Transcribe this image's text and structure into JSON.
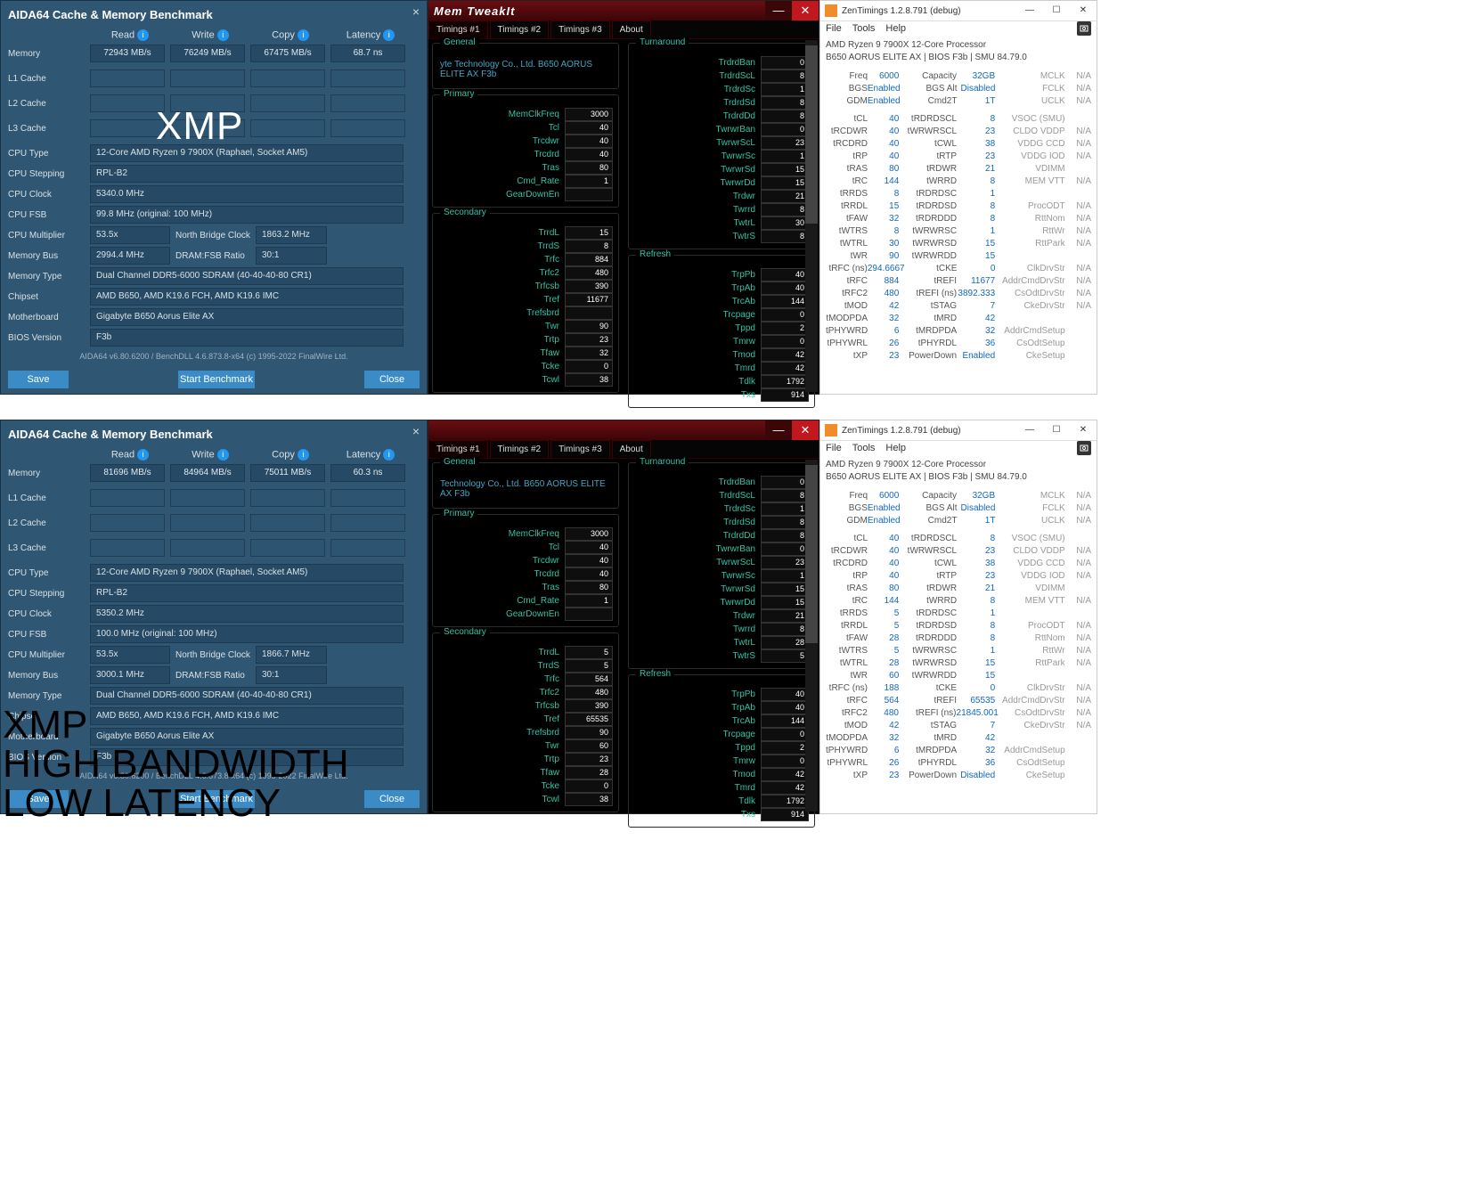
{
  "overlay_top": "XMP",
  "overlay_bottom": [
    "XMP",
    "HIGH BANDWIDTH",
    "LOW LATENCY"
  ],
  "aida": {
    "title": "AIDA64 Cache & Memory Benchmark",
    "headers": [
      "Read",
      "Write",
      "Copy",
      "Latency"
    ],
    "rows": [
      {
        "l": "Memory",
        "v": [
          "72943 MB/s",
          "76249 MB/s",
          "67475 MB/s",
          "68.7 ns"
        ]
      },
      {
        "l": "L1 Cache",
        "v": [
          "",
          "",
          "",
          ""
        ]
      },
      {
        "l": "L2 Cache",
        "v": [
          "",
          "",
          "",
          ""
        ]
      },
      {
        "l": "L3 Cache",
        "v": [
          "",
          "",
          "",
          ""
        ]
      }
    ],
    "info": [
      {
        "l": "CPU Type",
        "v": "12-Core AMD Ryzen 9 7900X  (Raphael, Socket AM5)"
      },
      {
        "l": "CPU Stepping",
        "v": "RPL-B2"
      },
      {
        "l": "CPU Clock",
        "v": "5340.0 MHz"
      },
      {
        "l": "CPU FSB",
        "v": "99.8 MHz  (original: 100 MHz)"
      }
    ],
    "multi": {
      "l": "CPU Multiplier",
      "v": "53.5x",
      "l2": "North Bridge Clock",
      "v2": "1863.2 MHz"
    },
    "bus": {
      "l": "Memory Bus",
      "v": "2994.4 MHz",
      "l2": "DRAM:FSB Ratio",
      "v2": "30:1"
    },
    "info2": [
      {
        "l": "Memory Type",
        "v": "Dual Channel DDR5-6000 SDRAM  (40-40-40-80 CR1)"
      },
      {
        "l": "Chipset",
        "v": "AMD B650, AMD K19.6 FCH, AMD K19.6 IMC"
      },
      {
        "l": "Motherboard",
        "v": "Gigabyte B650 Aorus Elite AX"
      },
      {
        "l": "BIOS Version",
        "v": "F3b"
      }
    ],
    "footer": "AIDA64 v6.80.6200 / BenchDLL 4.6.873.8-x64  (c) 1995-2022 FinalWire Ltd.",
    "btn": {
      "save": "Save",
      "start": "Start Benchmark",
      "close": "Close"
    }
  },
  "aida2": {
    "rows": [
      {
        "l": "Memory",
        "v": [
          "81696 MB/s",
          "84964 MB/s",
          "75011 MB/s",
          "60.3 ns"
        ]
      },
      {
        "l": "L1 Cache",
        "v": [
          "",
          "",
          "",
          ""
        ]
      },
      {
        "l": "L2 Cache",
        "v": [
          "",
          "",
          "",
          ""
        ]
      },
      {
        "l": "L3 Cache",
        "v": [
          "",
          "",
          "",
          ""
        ]
      }
    ],
    "info": [
      {
        "l": "CPU Type",
        "v": "12-Core AMD Ryzen 9 7900X  (Raphael, Socket AM5)"
      },
      {
        "l": "CPU Stepping",
        "v": "RPL-B2"
      },
      {
        "l": "CPU Clock",
        "v": "5350.2 MHz"
      },
      {
        "l": "CPU FSB",
        "v": "100.0 MHz  (original: 100 MHz)"
      }
    ],
    "multi": {
      "l": "CPU Multiplier",
      "v": "53.5x",
      "l2": "North Bridge Clock",
      "v2": "1866.7 MHz"
    },
    "bus": {
      "l": "Memory Bus",
      "v": "3000.1 MHz",
      "l2": "DRAM:FSB Ratio",
      "v2": "30:1"
    },
    "info2": [
      {
        "l": "Memory Type",
        "v": "Dual Channel DDR5-6000 SDRAM  (40-40-40-80 CR1)"
      },
      {
        "l": "Chipset",
        "v": "AMD B650, AMD K19.6 FCH, AMD K19.6 IMC"
      },
      {
        "l": "Motherboard",
        "v": "Gigabyte B650 Aorus Elite AX"
      },
      {
        "l": "BIOS Version",
        "v": "F3b"
      }
    ]
  },
  "mt": {
    "title": "Mem TweakIt",
    "tabs": [
      "Timings #1",
      "Timings #2",
      "Timings #3",
      "About"
    ],
    "mb": "yte Technology Co., Ltd. B650 AORUS ELITE AX F3b",
    "mb2": "Technology Co., Ltd. B650 AORUS ELITE AX F3b",
    "primary": [
      [
        "MemClkFreq",
        "3000"
      ],
      [
        "Tcl",
        "40"
      ],
      [
        "Trcdwr",
        "40"
      ],
      [
        "Trcdrd",
        "40"
      ],
      [
        "Tras",
        "80"
      ],
      [
        "Cmd_Rate",
        "1"
      ],
      [
        "GearDownEn",
        ""
      ]
    ],
    "secondary": [
      [
        "TrrdL",
        "15"
      ],
      [
        "TrrdS",
        "8"
      ],
      [
        "Trfc",
        "884"
      ],
      [
        "Trfc2",
        "480"
      ],
      [
        "Trfcsb",
        "390"
      ],
      [
        "Tref",
        "11677"
      ],
      [
        "Trefsbrd",
        ""
      ],
      [
        "Twr",
        "90"
      ],
      [
        "Trtp",
        "23"
      ],
      [
        "Tfaw",
        "32"
      ],
      [
        "Tcke",
        "0"
      ],
      [
        "Tcwl",
        "38"
      ]
    ],
    "secondary2": [
      [
        "TrrdL",
        "5"
      ],
      [
        "TrrdS",
        "5"
      ],
      [
        "Trfc",
        "564"
      ],
      [
        "Trfc2",
        "480"
      ],
      [
        "Trfcsb",
        "390"
      ],
      [
        "Tref",
        "65535"
      ],
      [
        "Trefsbrd",
        "90"
      ],
      [
        "Twr",
        "60"
      ],
      [
        "Trtp",
        "23"
      ],
      [
        "Tfaw",
        "28"
      ],
      [
        "Tcke",
        "0"
      ],
      [
        "Tcwl",
        "38"
      ]
    ],
    "turn": [
      [
        "TrdrdBan",
        "0"
      ],
      [
        "TrdrdScL",
        "8"
      ],
      [
        "TrdrdSc",
        "1"
      ],
      [
        "TrdrdSd",
        "8"
      ],
      [
        "TrdrdDd",
        "8"
      ],
      [
        "TwrwrBan",
        "0"
      ],
      [
        "TwrwrScL",
        "23"
      ],
      [
        "TwrwrSc",
        "1"
      ],
      [
        "TwrwrSd",
        "15"
      ],
      [
        "TwrwrDd",
        "15"
      ],
      [
        "Trdwr",
        "21"
      ],
      [
        "Twrrd",
        "8"
      ],
      [
        "TwtrL",
        "30"
      ],
      [
        "TwtrS",
        "8"
      ]
    ],
    "turn2": [
      [
        "TrdrdBan",
        "0"
      ],
      [
        "TrdrdScL",
        "8"
      ],
      [
        "TrdrdSc",
        "1"
      ],
      [
        "TrdrdSd",
        "8"
      ],
      [
        "TrdrdDd",
        "8"
      ],
      [
        "TwrwrBan",
        "0"
      ],
      [
        "TwrwrScL",
        "23"
      ],
      [
        "TwrwrSc",
        "1"
      ],
      [
        "TwrwrSd",
        "15"
      ],
      [
        "TwrwrDd",
        "15"
      ],
      [
        "Trdwr",
        "21"
      ],
      [
        "Twrrd",
        "8"
      ],
      [
        "TwtrL",
        "28"
      ],
      [
        "TwtrS",
        "5"
      ]
    ],
    "refresh": [
      [
        "TrpPb",
        "40"
      ],
      [
        "TrpAb",
        "40"
      ],
      [
        "TrcAb",
        "144"
      ],
      [
        "Trcpage",
        "0"
      ],
      [
        "Tppd",
        "2"
      ],
      [
        "Tmrw",
        "0"
      ],
      [
        "Tmod",
        "42"
      ],
      [
        "Tmrd",
        "42"
      ],
      [
        "Tdlk",
        "1792"
      ],
      [
        "Txs",
        "914"
      ]
    ],
    "refresh2": [
      [
        "TrpPb",
        "40"
      ],
      [
        "TrpAb",
        "40"
      ],
      [
        "TrcAb",
        "144"
      ],
      [
        "Trcpage",
        "0"
      ],
      [
        "Tppd",
        "2"
      ],
      [
        "Tmrw",
        "0"
      ],
      [
        "Tmod",
        "42"
      ],
      [
        "Tmrd",
        "42"
      ],
      [
        "Tdlk",
        "1792"
      ],
      [
        "Txs",
        "914"
      ]
    ]
  },
  "zt": {
    "title": "ZenTimings 1.2.8.791 (debug)",
    "menu": [
      "File",
      "Tools",
      "Help"
    ],
    "cpu": "AMD Ryzen 9 7900X 12-Core Processor",
    "mb": "B650 AORUS ELITE AX | BIOS F3b | SMU 84.79.0",
    "top": [
      [
        "Freq",
        "6000",
        "Capacity",
        "32GB",
        "MCLK",
        "N/A"
      ],
      [
        "BGS",
        "Enabled",
        "BGS Alt",
        "Disabled",
        "FCLK",
        "N/A"
      ],
      [
        "GDM",
        "Enabled",
        "Cmd2T",
        "1T",
        "UCLK",
        "N/A"
      ]
    ],
    "body": [
      [
        "tCL",
        "40",
        "tRDRDSCL",
        "8",
        "VSOC (SMU)",
        ""
      ],
      [
        "tRCDWR",
        "40",
        "tWRWRSCL",
        "23",
        "CLDO VDDP",
        "N/A"
      ],
      [
        "tRCDRD",
        "40",
        "tCWL",
        "38",
        "VDDG CCD",
        "N/A"
      ],
      [
        "tRP",
        "40",
        "tRTP",
        "23",
        "VDDG IOD",
        "N/A"
      ],
      [
        "tRAS",
        "80",
        "tRDWR",
        "21",
        "VDIMM",
        ""
      ],
      [
        "tRC",
        "144",
        "tWRRD",
        "8",
        "MEM VTT",
        "N/A"
      ],
      [
        "tRRDS",
        "8",
        "tRDRDSC",
        "1",
        "",
        ""
      ],
      [
        "tRRDL",
        "15",
        "tRDRDSD",
        "8",
        "ProcODT",
        "N/A"
      ],
      [
        "tFAW",
        "32",
        "tRDRDDD",
        "8",
        "RttNom",
        "N/A"
      ],
      [
        "tWTRS",
        "8",
        "tWRWRSC",
        "1",
        "RttWr",
        "N/A"
      ],
      [
        "tWTRL",
        "30",
        "tWRWRSD",
        "15",
        "RttPark",
        "N/A"
      ],
      [
        "tWR",
        "90",
        "tWRWRDD",
        "15",
        "",
        ""
      ],
      [
        "tRFC (ns)",
        "294.6667",
        "tCKE",
        "0",
        "ClkDrvStr",
        "N/A"
      ],
      [
        "tRFC",
        "884",
        "tREFI",
        "11677",
        "AddrCmdDrvStr",
        "N/A"
      ],
      [
        "tRFC2",
        "480",
        "tREFI (ns)",
        "3892.333",
        "CsOdtDrvStr",
        "N/A"
      ],
      [
        "tMOD",
        "42",
        "tSTAG",
        "7",
        "CkeDrvStr",
        "N/A"
      ],
      [
        "tMODPDA",
        "32",
        "tMRD",
        "42",
        "",
        ""
      ],
      [
        "tPHYWRD",
        "6",
        "tMRDPDA",
        "32",
        "AddrCmdSetup",
        ""
      ],
      [
        "tPHYWRL",
        "26",
        "tPHYRDL",
        "36",
        "CsOdtSetup",
        ""
      ],
      [
        "tXP",
        "23",
        "PowerDown",
        "Enabled",
        "CkeSetup",
        ""
      ]
    ],
    "body2": [
      [
        "tCL",
        "40",
        "tRDRDSCL",
        "8",
        "VSOC (SMU)",
        ""
      ],
      [
        "tRCDWR",
        "40",
        "tWRWRSCL",
        "23",
        "CLDO VDDP",
        "N/A"
      ],
      [
        "tRCDRD",
        "40",
        "tCWL",
        "38",
        "VDDG CCD",
        "N/A"
      ],
      [
        "tRP",
        "40",
        "tRTP",
        "23",
        "VDDG IOD",
        "N/A"
      ],
      [
        "tRAS",
        "80",
        "tRDWR",
        "21",
        "VDIMM",
        ""
      ],
      [
        "tRC",
        "144",
        "tWRRD",
        "8",
        "MEM VTT",
        "N/A"
      ],
      [
        "tRRDS",
        "5",
        "tRDRDSC",
        "1",
        "",
        ""
      ],
      [
        "tRRDL",
        "5",
        "tRDRDSD",
        "8",
        "ProcODT",
        "N/A"
      ],
      [
        "tFAW",
        "28",
        "tRDRDDD",
        "8",
        "RttNom",
        "N/A"
      ],
      [
        "tWTRS",
        "5",
        "tWRWRSC",
        "1",
        "RttWr",
        "N/A"
      ],
      [
        "tWTRL",
        "28",
        "tWRWRSD",
        "15",
        "RttPark",
        "N/A"
      ],
      [
        "tWR",
        "60",
        "tWRWRDD",
        "15",
        "",
        ""
      ],
      [
        "tRFC (ns)",
        "188",
        "tCKE",
        "0",
        "ClkDrvStr",
        "N/A"
      ],
      [
        "tRFC",
        "564",
        "tREFI",
        "65535",
        "AddrCmdDrvStr",
        "N/A"
      ],
      [
        "tRFC2",
        "480",
        "tREFI (ns)",
        "21845.001",
        "CsOdtDrvStr",
        "N/A"
      ],
      [
        "tMOD",
        "42",
        "tSTAG",
        "7",
        "CkeDrvStr",
        "N/A"
      ],
      [
        "tMODPDA",
        "32",
        "tMRD",
        "42",
        "",
        ""
      ],
      [
        "tPHYWRD",
        "6",
        "tMRDPDA",
        "32",
        "AddrCmdSetup",
        ""
      ],
      [
        "tPHYWRL",
        "26",
        "tPHYRDL",
        "36",
        "CsOdtSetup",
        ""
      ],
      [
        "tXP",
        "23",
        "PowerDown",
        "Disabled",
        "CkeSetup",
        ""
      ]
    ]
  }
}
